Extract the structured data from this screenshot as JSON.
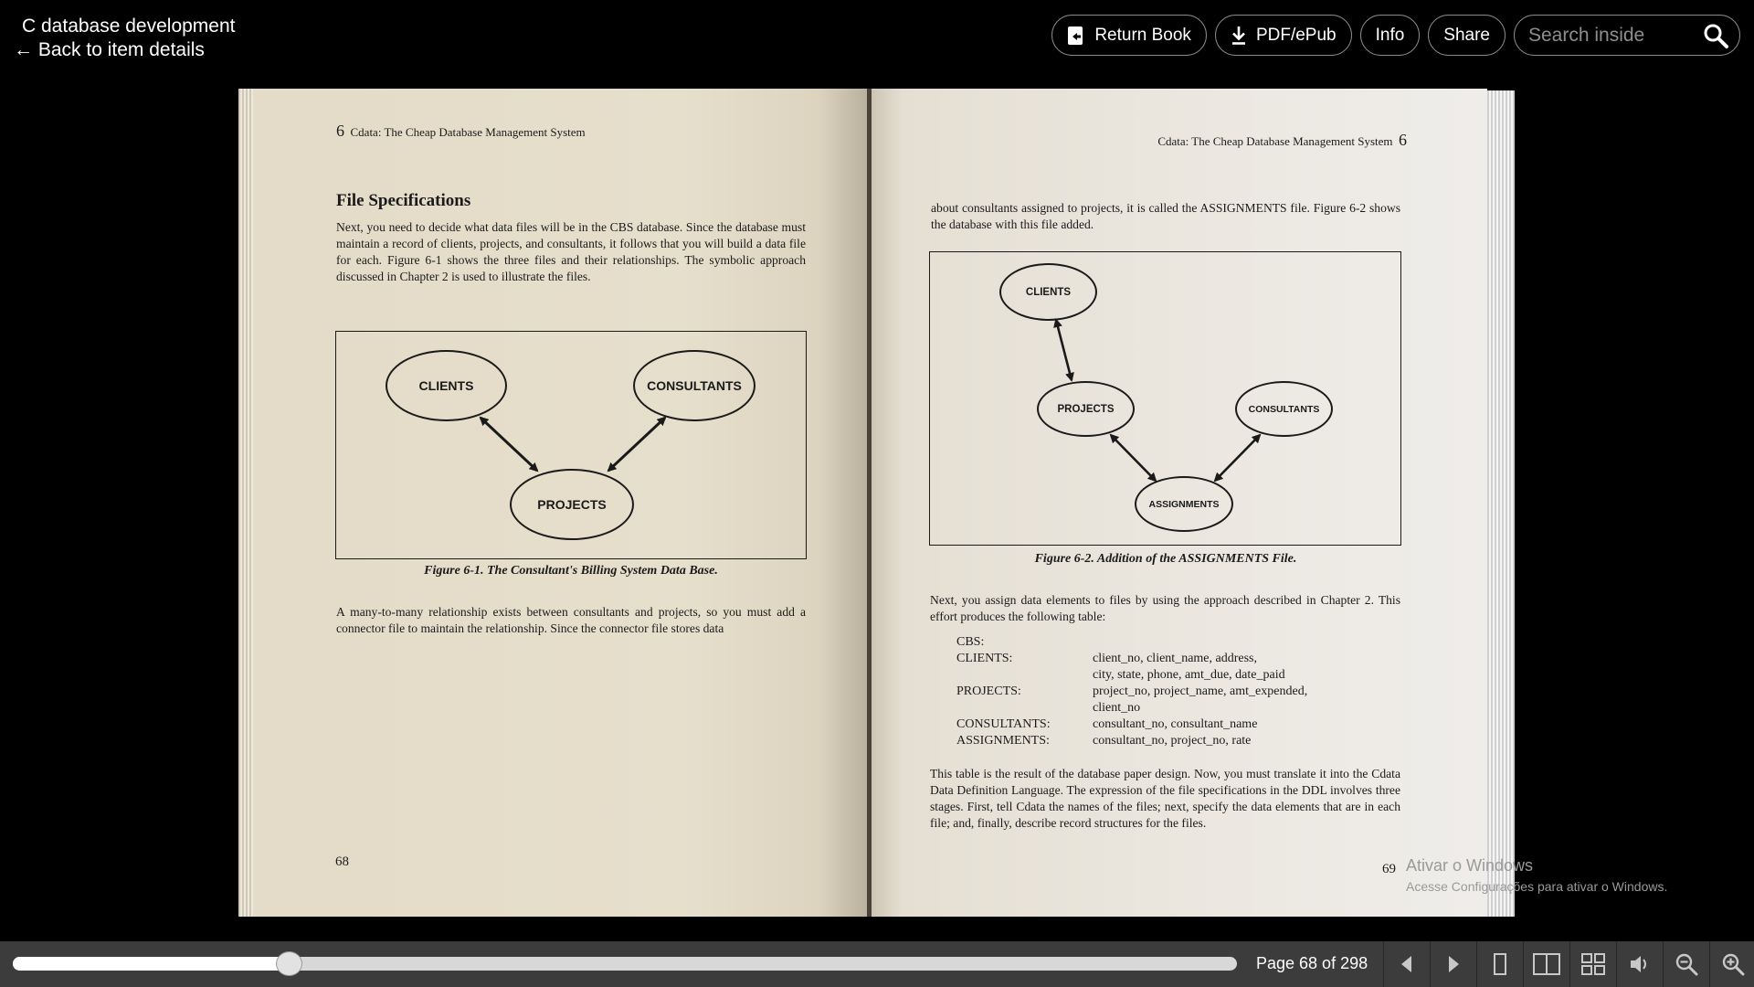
{
  "header": {
    "book_title": "C database development",
    "back_link": "← Back to item details",
    "buttons": {
      "return_book": "Return Book",
      "pdf_epub": "PDF/ePub",
      "info": "Info",
      "share": "Share"
    },
    "search_placeholder": "Search inside"
  },
  "left_page": {
    "chapter_num": "6",
    "running_head": "Cdata: The Cheap Database Management System",
    "section_title": "File Specifications",
    "para1": "Next, you need to decide what data files will be in the CBS database. Since the database must maintain a record of clients, projects, and consultants, it follows that you will build a data file for each. Figure 6-1 shows the three files and their relationships. The symbolic approach discussed in Chapter 2 is used to illustrate the files.",
    "figure": {
      "nodes": {
        "clients": "CLIENTS",
        "consultants": "CONSULTANTS",
        "projects": "PROJECTS"
      },
      "caption": "Figure 6-1.  The Consultant's Billing System Data Base."
    },
    "para2": "A many-to-many relationship exists between consultants and projects, so you must add a connector file to maintain the relationship. Since the connector file stores data",
    "page_number": "68"
  },
  "right_page": {
    "running_head": "Cdata: The Cheap Database Management System",
    "chapter_num": "6",
    "para1": "about consultants assigned to projects, it is called the ASSIGNMENTS file. Figure 6-2 shows the database with this file added.",
    "figure": {
      "nodes": {
        "clients": "CLIENTS",
        "projects": "PROJECTS",
        "consultants": "CONSULTANTS",
        "assignments": "ASSIGNMENTS"
      },
      "caption": "Figure 6-2.  Addition of the ASSIGNMENTS File."
    },
    "para2": "Next, you assign data elements to files by using the approach described in Chapter 2. This effort produces the following table:",
    "table": [
      {
        "k": "CBS:",
        "v": ""
      },
      {
        "k": "CLIENTS:",
        "v": "client_no, client_name, address,"
      },
      {
        "k": "",
        "v": "city, state, phone, amt_due, date_paid"
      },
      {
        "k": "PROJECTS:",
        "v": "project_no, project_name, amt_expended,"
      },
      {
        "k": "",
        "v": "client_no"
      },
      {
        "k": "CONSULTANTS:",
        "v": "consultant_no, consultant_name"
      },
      {
        "k": "ASSIGNMENTS:",
        "v": "consultant_no, project_no, rate"
      }
    ],
    "para3": "This table is the result of the database paper design. Now, you must translate it into the Cdata Data Definition Language. The expression of the file specifications in the DDL involves three stages. First, tell Cdata the names of the files; next, specify the data elements that are in each file; and, finally, describe record structures for the files.",
    "page_number": "69"
  },
  "watermark": {
    "title": "Ativar o Windows",
    "subtitle": "Acesse Configurações para ativar o Windows."
  },
  "bottombar": {
    "page_indicator": "Page 68 of 298",
    "progress": {
      "current_page": 68,
      "total_pages": 298
    },
    "tools": [
      "prev-page-icon",
      "next-page-icon",
      "one-page-view-icon",
      "two-page-view-icon",
      "thumbnail-view-icon",
      "read-aloud-icon",
      "zoom-out-icon",
      "zoom-in-icon"
    ]
  },
  "colors": {
    "background": "#000000",
    "bar": "#3c3c3c",
    "ink": "#1a1a1a"
  }
}
